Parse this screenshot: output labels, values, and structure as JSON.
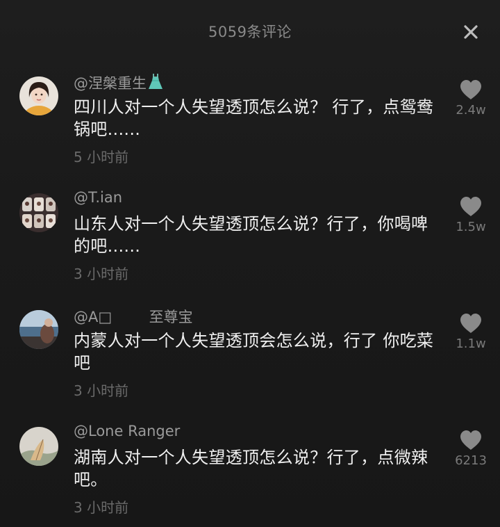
{
  "header": {
    "title": "5059条评论",
    "close_icon": "close-icon"
  },
  "comments": [
    {
      "username": "@涅槃重生",
      "username_icon": "dress-icon",
      "text": "四川人对一个人失望透顶怎么说？ 行了，点鸳鸯锅吧......",
      "time": "5 小时前",
      "likes": "2.4w"
    },
    {
      "username": "@T.ian",
      "text": "山东人对一个人失望透顶怎么说？行了，你喝啤的吧......",
      "time": "3 小时前",
      "likes": "1.5w"
    },
    {
      "username": "@A□        至尊宝",
      "text": "内蒙人对一个人失望透顶会怎么说，行了 你吃菜吧",
      "time": "3 小时前",
      "likes": "1.1w"
    },
    {
      "username": "@Lone Ranger",
      "text": "湖南人对一个人失望透顶怎么说？行了，点微辣吧。",
      "time": "3 小时前",
      "likes": "6213"
    }
  ],
  "colors": {
    "background": "#1a1a1a",
    "text_primary": "#f0f0f0",
    "text_secondary": "#9a9a9a",
    "text_muted": "#6a6a6a",
    "heart": "#8a8a8a"
  }
}
